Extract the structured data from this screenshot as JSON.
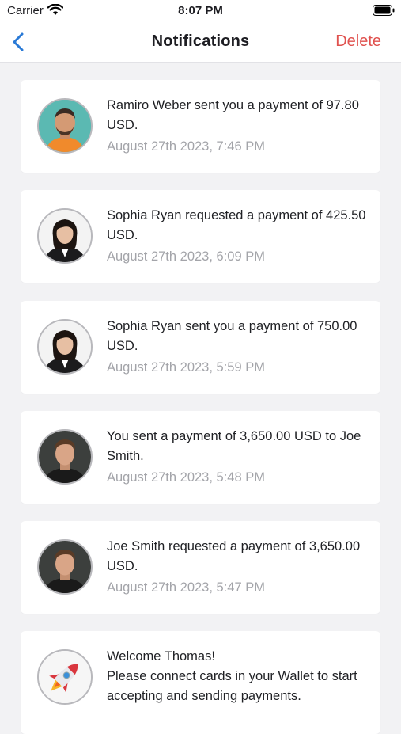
{
  "status": {
    "carrier": "Carrier",
    "time": "8:07 PM"
  },
  "nav": {
    "title": "Notifications",
    "delete_label": "Delete"
  },
  "notifications": [
    {
      "text": "Ramiro Weber sent you a payment of 97.80 USD.",
      "time": "August 27th 2023, 7:46 PM"
    },
    {
      "text": "Sophia Ryan requested a payment of 425.50 USD.",
      "time": "August 27th 2023, 6:09 PM"
    },
    {
      "text": "Sophia Ryan sent you a payment of 750.00 USD.",
      "time": "August 27th 2023, 5:59 PM"
    },
    {
      "text": "You sent a payment of 3,650.00 USD to Joe Smith.",
      "time": "August 27th 2023, 5:48 PM"
    },
    {
      "text": "Joe Smith requested a payment of 3,650.00 USD.",
      "time": "August 27th 2023, 5:47 PM"
    }
  ],
  "welcome": {
    "line1": "Welcome Thomas!",
    "line2": "Please connect cards in your Wallet to start accepting and sending payments."
  },
  "colors": {
    "accent": "#2a7ad6",
    "delete": "#e0524f",
    "timestamp": "#a3a4a9"
  }
}
